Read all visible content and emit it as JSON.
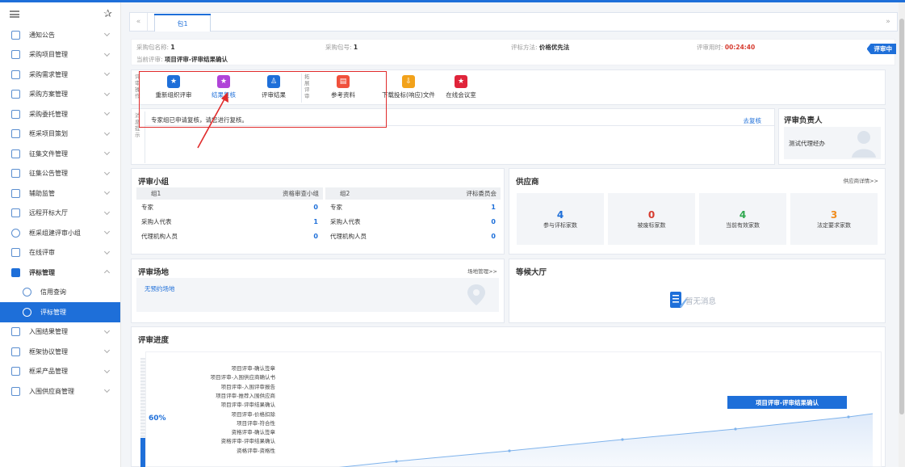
{
  "sidebar": {
    "items": [
      {
        "label": "通知公告"
      },
      {
        "label": "采购项目管理"
      },
      {
        "label": "采购需求管理"
      },
      {
        "label": "采购方案管理"
      },
      {
        "label": "采购委托管理"
      },
      {
        "label": "框采项目策划"
      },
      {
        "label": "征集文件管理"
      },
      {
        "label": "征集公告管理"
      },
      {
        "label": "辅助监管"
      },
      {
        "label": "远程开标大厅"
      },
      {
        "label": "框采组建评审小组"
      },
      {
        "label": "在线评审"
      },
      {
        "label": "评标管理"
      },
      {
        "label": "信用查询"
      },
      {
        "label": "评标管理"
      },
      {
        "label": "入围结果管理"
      },
      {
        "label": "框架协议管理"
      },
      {
        "label": "框采产品管理"
      },
      {
        "label": "入围供应商管理"
      }
    ]
  },
  "tabs": {
    "active": "包1"
  },
  "info": {
    "package_name_label": "采购包名称:",
    "package_name_value": "1",
    "package_no_label": "采购包号:",
    "package_no_value": "1",
    "method_label": "评标方法:",
    "method_value": "价格优先法",
    "time_label": "评审用时:",
    "time_value": "00:24:40",
    "status": "评审中",
    "current_label": "当前评审:",
    "current_value": "项目评审-评审结果确认"
  },
  "actions": {
    "group1_label": "评审操作",
    "group2_label": "拓展评审",
    "reorganize": "重新组织评审",
    "result_review": "结果复核",
    "review_result": "评审结果",
    "reference": "参考资料",
    "download": "下载投标(响应)文件",
    "meeting": "在线会议室"
  },
  "notice": {
    "side_label": "消息提示",
    "text": "专家组已申请复核，请您进行复核。",
    "link": "去复核"
  },
  "owner": {
    "title": "评审负责人",
    "name": "测试代理经办"
  },
  "group_panel": {
    "title": "评审小组",
    "groups": [
      {
        "name": "组1",
        "type": "资格审查小组",
        "rows": [
          {
            "role": "专家",
            "count": "0"
          },
          {
            "role": "采购人代表",
            "count": "1"
          },
          {
            "role": "代理机构人员",
            "count": "0"
          }
        ]
      },
      {
        "name": "组2",
        "type": "评标委员会",
        "rows": [
          {
            "role": "专家",
            "count": "1"
          },
          {
            "role": "采购人代表",
            "count": "0"
          },
          {
            "role": "代理机构人员",
            "count": "0"
          }
        ]
      }
    ]
  },
  "supplier_panel": {
    "title": "供应商",
    "link": "供应商详情>>",
    "stats": [
      {
        "value": "4",
        "label": "参与评标家数",
        "color": "#1e6fd9"
      },
      {
        "value": "0",
        "label": "被废标家数",
        "color": "#d63b2f"
      },
      {
        "value": "4",
        "label": "当前有效家数",
        "color": "#2fa84f"
      },
      {
        "value": "3",
        "label": "法定要求家数",
        "color": "#f08c1e"
      }
    ]
  },
  "venue_panel": {
    "title": "评审场地",
    "link": "场地管理>>",
    "empty": "无预约场地"
  },
  "lobby_panel": {
    "title": "等候大厅",
    "empty": "暂无消息"
  },
  "progress_panel": {
    "title": "评审进度",
    "percent": "60%",
    "percent_value": 60,
    "steps": [
      "项目评审-确认签章",
      "项目评审-入围供应商确认书",
      "项目评审-入围评审报告",
      "项目评审-推荐入围供应商",
      "项目评审-评审结果确认",
      "项目评审-价格扣除",
      "项目评审-符合性",
      "资格评审-确认签章",
      "资格评审-评审结果确认",
      "资格评审-资格性"
    ],
    "current_step": "项目评审-评审结果确认"
  }
}
